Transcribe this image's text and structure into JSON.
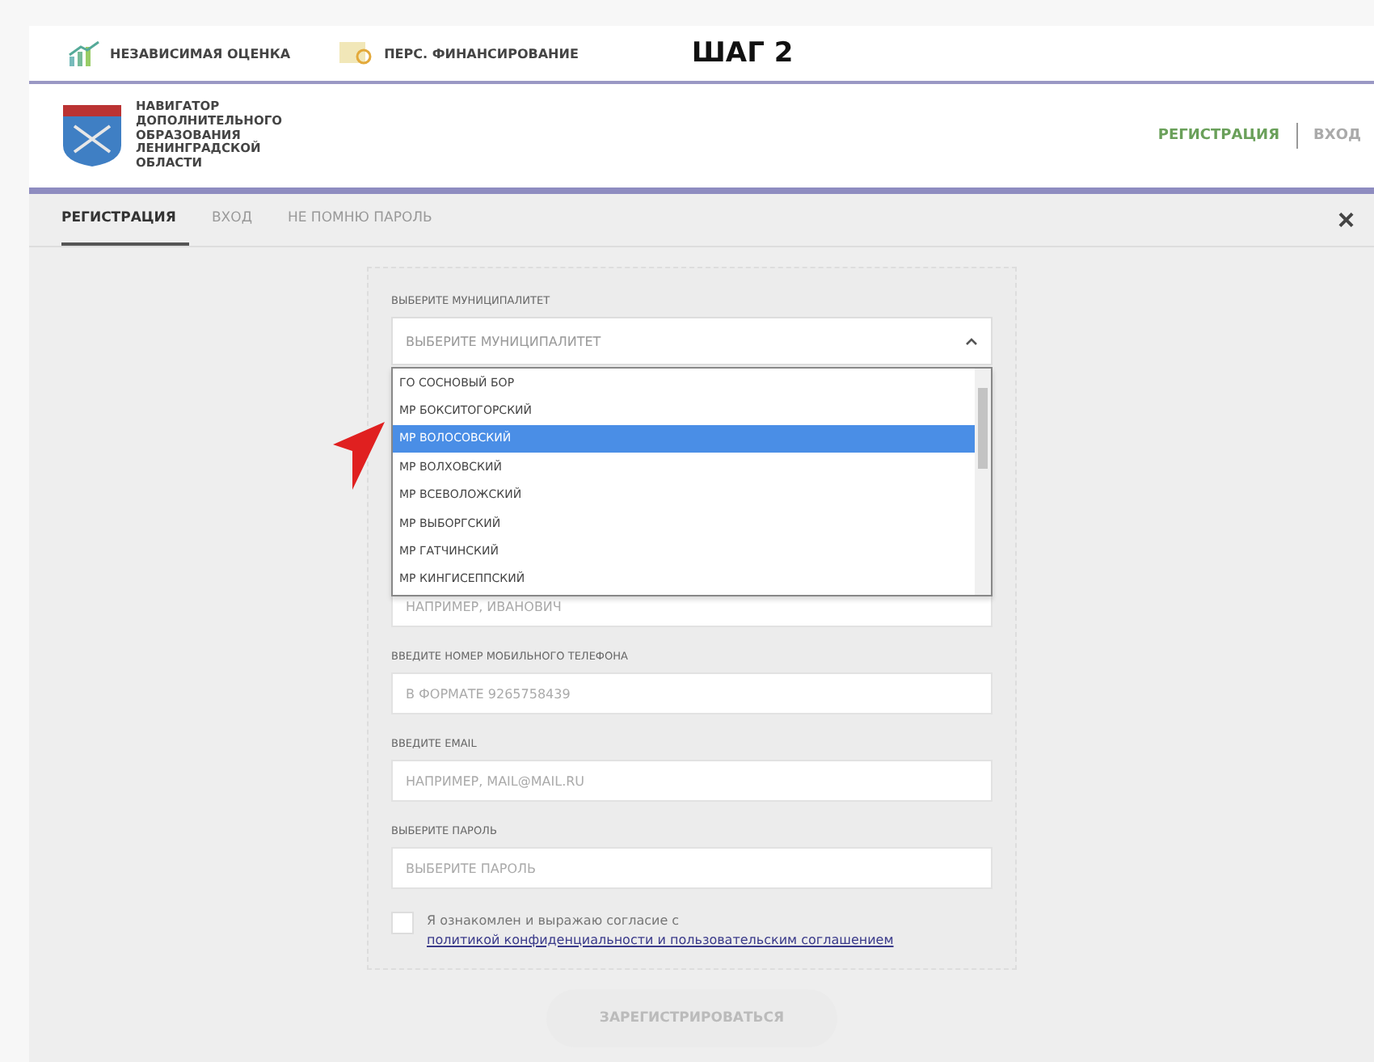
{
  "top_bar": {
    "links": [
      "НЕЗАВИСИМАЯ ОЦЕНКА",
      "ПЕРС. ФИНАНСИРОВАНИЕ"
    ],
    "step": "ШАГ 2"
  },
  "header": {
    "title": "НАВИГАТОР ДОПОЛНИТЕЛЬНОГО ОБРАЗОВАНИЯ ЛЕНИНГРАДСКОЙ ОБЛАСТИ",
    "nav": [
      {
        "label": "РЕГИСТРАЦИЯ",
        "selected": true
      },
      {
        "label": "ВХОД",
        "selected": false
      }
    ]
  },
  "tabs": [
    {
      "label": "РЕГИСТРАЦИЯ",
      "selected": true
    },
    {
      "label": "ВХОД",
      "selected": false
    },
    {
      "label": "НЕ ПОМНЮ ПАРОЛЬ",
      "selected": false
    }
  ],
  "close": "×",
  "form": {
    "municipality": {
      "label": "ВЫБЕРИТЕ МУНИЦИПАЛИТЕТ",
      "placeholder": "ВЫБЕРИТЕ МУНИЦИПАЛИТЕТ",
      "expanded": true,
      "options": [
        {
          "label": "ГО СОСНОВЫЙ БОР",
          "selected": false
        },
        {
          "label": "МР БОКСИТОГОРСКИЙ",
          "selected": false
        },
        {
          "label": "МР ВОЛОСОВСКИЙ",
          "selected": true
        },
        {
          "label": "МР ВОЛХОВСКИЙ",
          "selected": false
        },
        {
          "label": "МР ВСЕВОЛОЖСКИЙ",
          "selected": false
        },
        {
          "label": "МР ВЫБОРГСКИЙ",
          "selected": false
        },
        {
          "label": "МР ГАТЧИНСКИЙ",
          "selected": false
        },
        {
          "label": "МР КИНГИСЕППСКИЙ",
          "selected": false
        }
      ]
    },
    "covered_field": {
      "placeholder": "НАПРИМЕР, ИВАНОВИЧ"
    },
    "fields": [
      {
        "label": "ВВЕДИТЕ НОМЕР МОБИЛЬНОГО ТЕЛЕФОНА",
        "placeholder": "В ФОРМАТЕ 9265758439"
      },
      {
        "label": "ВВЕДИТЕ EMAIL",
        "placeholder": "НАПРИМЕР, MAIL@MAIL.RU"
      },
      {
        "label": "ВЫБЕРИТЕ ПАРОЛЬ",
        "placeholder": "ВЫБЕРИТЕ ПАРОЛЬ"
      }
    ],
    "consent": {
      "checked": false,
      "text": "Я ознакомлен и выражаю согласие с ",
      "link": "политикой конфиденциальности и пользовательским соглашением"
    },
    "submit": {
      "label": "ЗАРЕГИСТРИРОВАТЬСЯ",
      "disabled": true
    }
  }
}
